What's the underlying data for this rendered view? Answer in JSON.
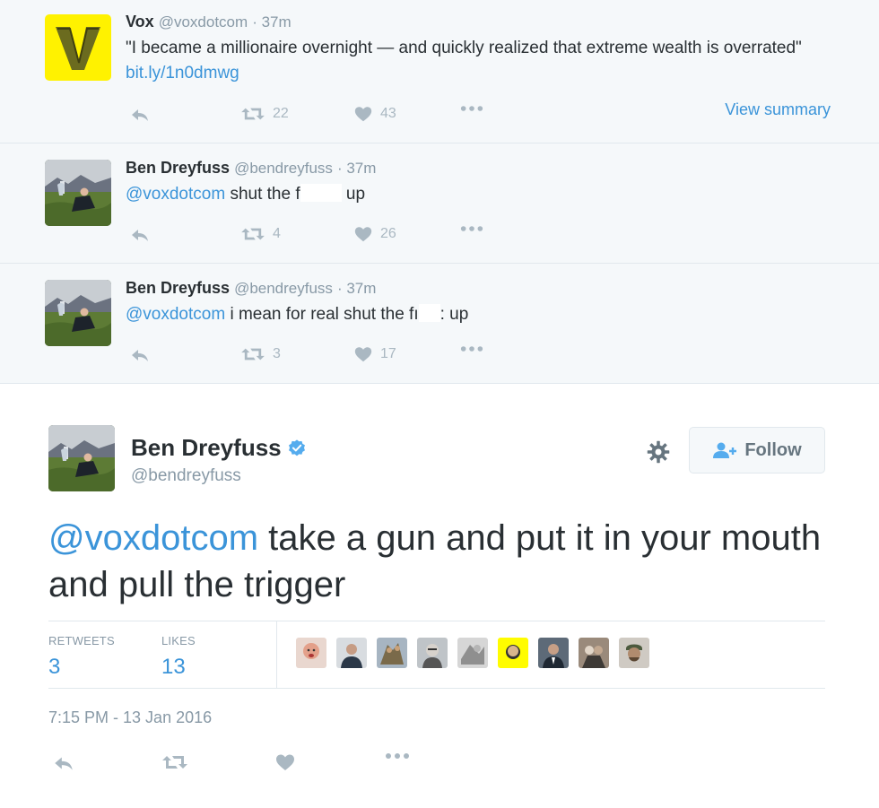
{
  "colors": {
    "link": "#3b94d9",
    "muted": "#8899a6",
    "icon": "#aab8c2",
    "vox_yellow": "#fff200"
  },
  "conversation": [
    {
      "name": "Vox",
      "handle": "@voxdotcom",
      "time": "· 37m",
      "text_before": "\"I became a millionaire overnight — and quickly realized that extreme wealth is overrated\" ",
      "link": "bit.ly/1n0dmwg",
      "retweets": "22",
      "likes": "43",
      "view_summary": "View summary"
    },
    {
      "name": "Ben Dreyfuss",
      "handle": "@bendreyfuss",
      "time": "· 37m",
      "mention": "@voxdotcom",
      "text_a": " shut the f",
      "text_b": " up",
      "retweets": "4",
      "likes": "26"
    },
    {
      "name": "Ben Dreyfuss",
      "handle": "@bendreyfuss",
      "time": "· 37m",
      "mention": "@voxdotcom",
      "text_a": " i mean for real shut the fı",
      "text_b": ": up",
      "retweets": "3",
      "likes": "17"
    }
  ],
  "main_tweet": {
    "name": "Ben Dreyfuss",
    "handle": "@bendreyfuss",
    "follow_label": "Follow",
    "mention": "@voxdotcom",
    "text": " take a gun and put it in your mouth and pull the trigger",
    "retweets_label": "RETWEETS",
    "retweets": "3",
    "likes_label": "LIKES",
    "likes": "13",
    "timestamp": "7:15 PM - 13 Jan 2016"
  },
  "icons": [
    "reply-icon",
    "retweet-icon",
    "heart-icon",
    "more-icon",
    "gear-icon",
    "add-user-icon",
    "verified-icon"
  ]
}
